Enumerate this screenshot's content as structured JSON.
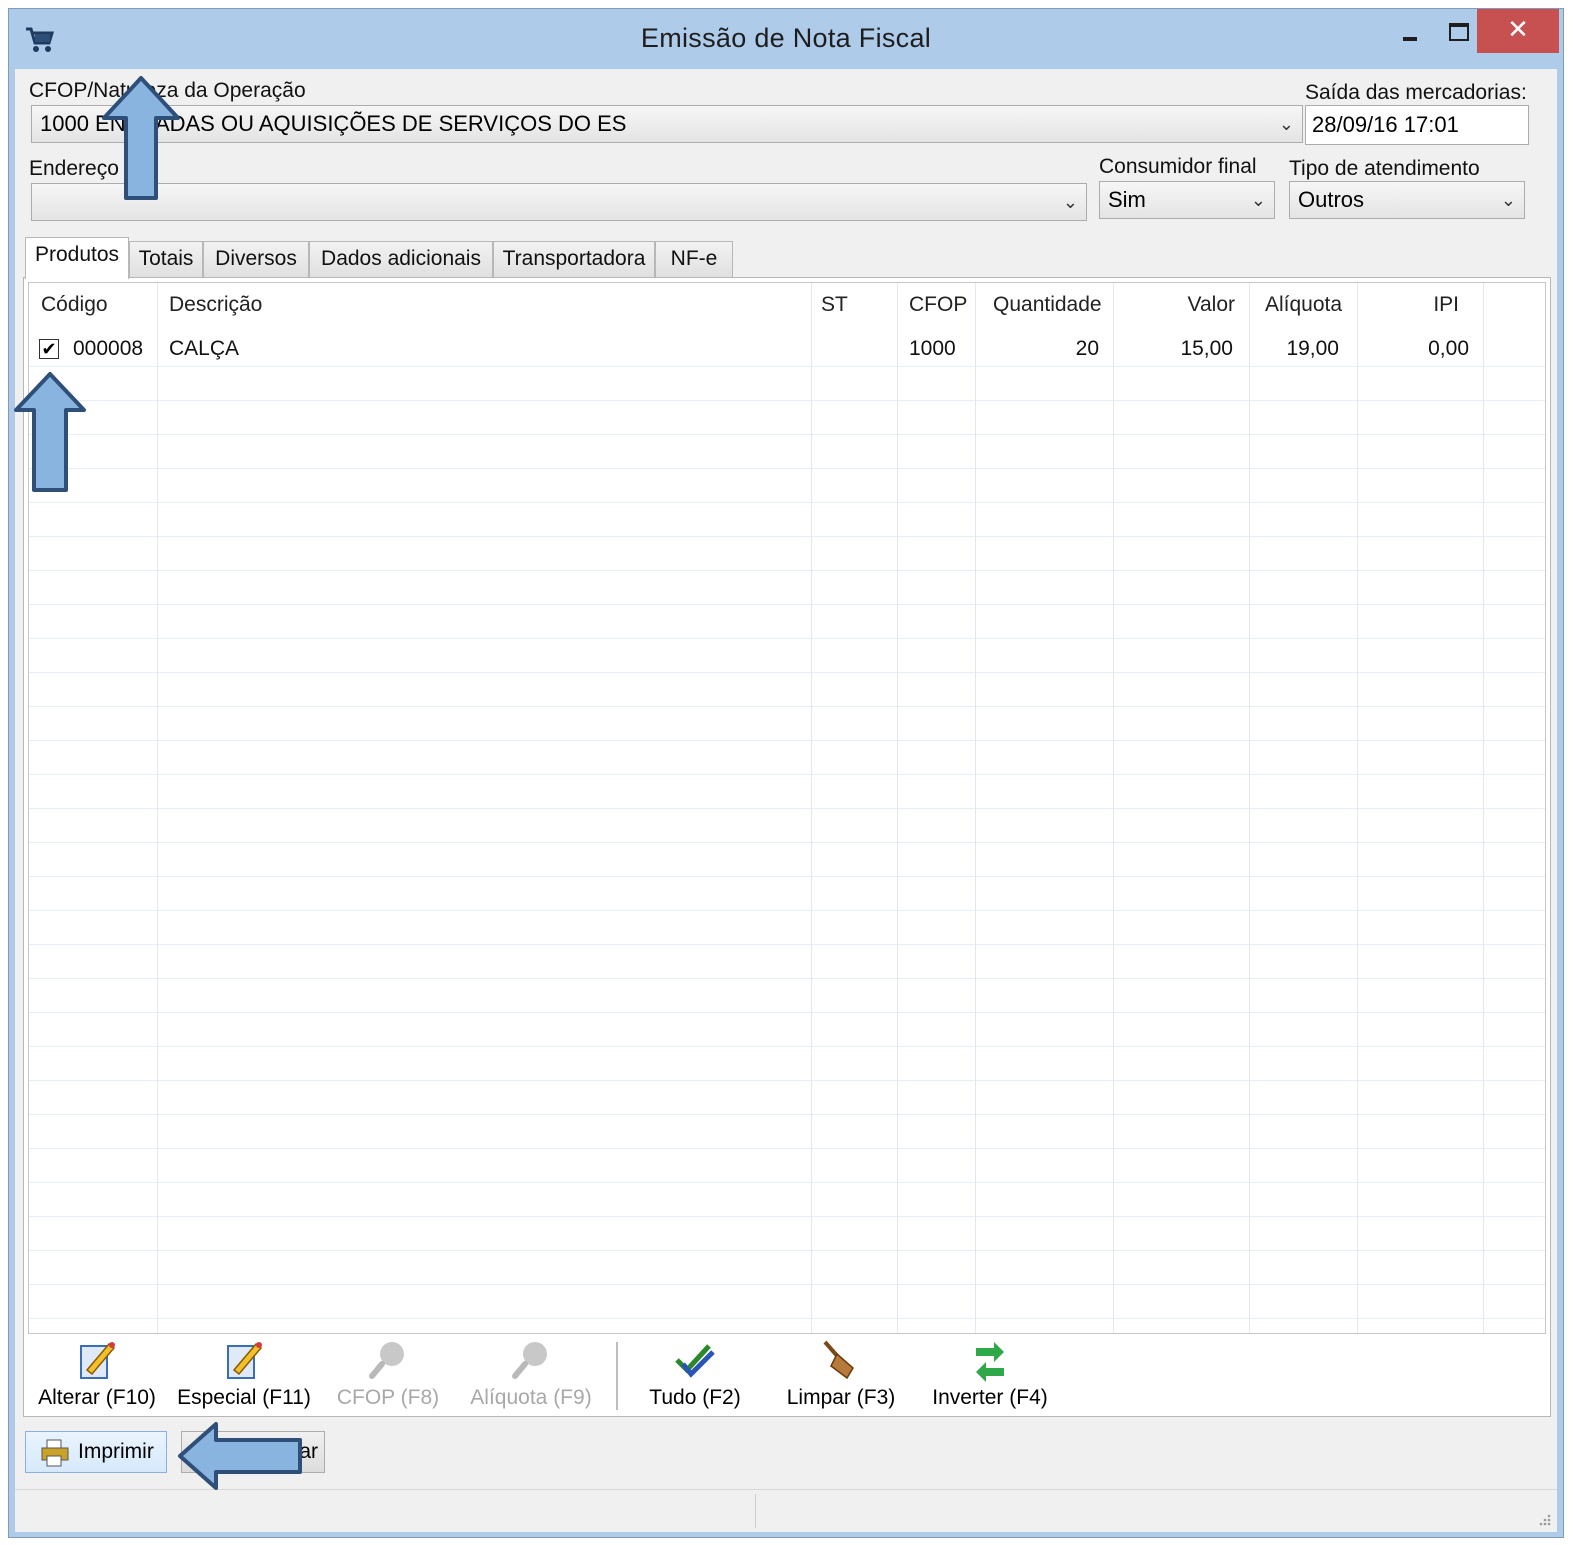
{
  "window": {
    "title": "Emissão de Nota Fiscal",
    "close_glyph": "✕"
  },
  "header": {
    "cfop_label": "CFOP/Natureza da Operação",
    "cfop_value": "1000 ENTRADAS OU AQUISIÇÕES DE SERVIÇOS DO ES",
    "saida_label": "Saída das mercadorias:",
    "saida_value": "28/09/16 17:01",
    "endereco_label": "Endereço",
    "endereco_value": "",
    "consumidor_label": "Consumidor final",
    "consumidor_value": "Sim",
    "tipo_label": "Tipo de atendimento",
    "tipo_value": "Outros",
    "dropdown_glyph": "⌄"
  },
  "tabs": [
    {
      "label": "Produtos"
    },
    {
      "label": "Totais"
    },
    {
      "label": "Diversos"
    },
    {
      "label": "Dados adicionais"
    },
    {
      "label": "Transportadora"
    },
    {
      "label": "NF-e"
    }
  ],
  "grid": {
    "columns": [
      "Código",
      "Descrição",
      "ST",
      "CFOP",
      "Quantidade",
      "Valor",
      "Alíquota",
      "IPI"
    ],
    "rows": [
      {
        "checked": "✔",
        "codigo": "000008",
        "descricao": "CALÇA",
        "st": "",
        "cfop": "1000",
        "quantidade": "20",
        "valor": "15,00",
        "aliquota": "19,00",
        "ipi": "0,00"
      }
    ]
  },
  "toolbar": {
    "alterar": "Alterar (F10)",
    "especial": "Especial (F11)",
    "cfop": "CFOP (F8)",
    "aliquota": "Alíquota (F9)",
    "tudo": "Tudo (F2)",
    "limpar": "Limpar (F3)",
    "inverter": "Inverter (F4)"
  },
  "footer": {
    "imprimir": "Imprimir",
    "second_partial": "ar"
  },
  "colors": {
    "title_bg": "#aecbea",
    "close_bg": "#c75050",
    "annotation_arrow": "#8ab4e0"
  }
}
